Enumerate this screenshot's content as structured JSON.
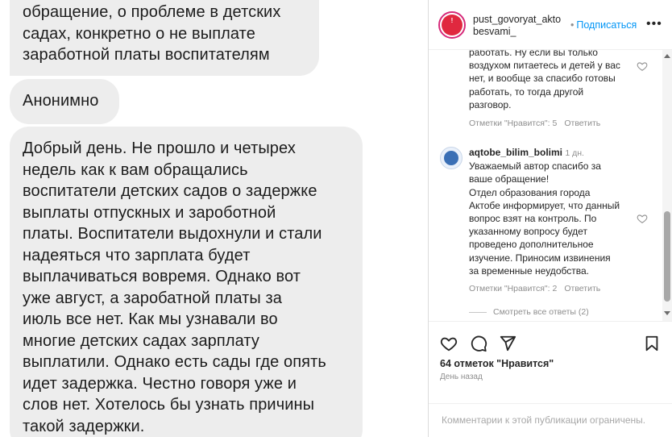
{
  "chat": {
    "bubble1_lines": [
      "обращение, о проблеме в детских",
      "садах, конкретно о не выплате",
      "заработной платы воспитателям"
    ],
    "bubble2": "Анонимно",
    "bubble3_lines": [
      "Добрый день.  Не прошло и четырех",
      "недель как к вам обращались",
      "воспитатели детских садов о задержке",
      "выплаты отпускных и зароботной",
      "платы. Воспитатели выдохнули и стали",
      "надеяться что зарплата будет",
      "выплачиваться вовремя. Однако вот",
      "уже август, а заробатной платы за",
      "июль все нет. Как мы узнавали во",
      "многие детских садах зарплату",
      "выплатили. Однако есть сады где опять",
      "идет задержка. Честно говоря уже и",
      "слов нет. Хотелось бы узнать причины",
      "такой задержки."
    ]
  },
  "header": {
    "username_line1": "pust_govoryat_akto",
    "username_line2": "besvami_",
    "follow_label": "Подписаться",
    "more_label": "•••"
  },
  "comments": {
    "c1": {
      "lines": [
        "работать. Ну если вы только",
        "воздухом питаетесь и детей у вас",
        "нет, и вообще за спасибо готовы",
        "работать, то тогда другой",
        "разговор."
      ],
      "likes": "Отметки \"Нравится\": 5",
      "reply": "Ответить"
    },
    "c2": {
      "username": "aqtobe_bilim_bolimi",
      "time": "1 дн.",
      "lines": [
        "Уважаемый автор спасибо за",
        "ваше обращение!",
        "Отдел образования города",
        "Актобе информирует, что данный",
        "вопрос взят на контроль. По",
        "указанному вопросу будет",
        "проведено дополнительное",
        "изучение. Приносим извинения",
        "за временные неудобства."
      ],
      "likes": "Отметки \"Нравится\": 2",
      "reply": "Ответить"
    },
    "view_replies": "Смотреть все ответы (2)"
  },
  "actions": {
    "likes": "64 отметок \"Нравится\"",
    "date": "День назад"
  },
  "footer": {
    "restricted": "Комментарии к этой публикации ограничены."
  },
  "colors": {
    "link_blue": "#0095f6",
    "muted_gray": "#8e8e8e",
    "bubble_gray": "#ededed"
  }
}
